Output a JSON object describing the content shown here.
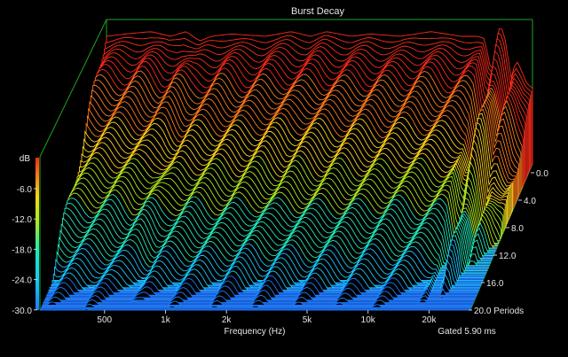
{
  "chart_data": {
    "type": "waterfall",
    "title": "Burst Decay",
    "xlabel": "Frequency (Hz)",
    "x_scale": "log",
    "x_ticks": [
      {
        "value": 500,
        "label": "500"
      },
      {
        "value": 1000,
        "label": "1k"
      },
      {
        "value": 2000,
        "label": "2k"
      },
      {
        "value": 5000,
        "label": "5k"
      },
      {
        "value": 10000,
        "label": "10k"
      },
      {
        "value": 20000,
        "label": "20k"
      }
    ],
    "xlim": [
      240,
      32000
    ],
    "zlabel": "dB",
    "z_ticks": [
      "-6.0",
      "-12.0",
      "-18.0",
      "-24.0",
      "-30.0"
    ],
    "zlim": [
      -30,
      0
    ],
    "y_ticks": [
      "0.0",
      "4.0",
      "8.0",
      "12.0",
      "16.0",
      "20.0 Periods"
    ],
    "ylim": [
      0,
      20
    ],
    "footnote": "Gated 5.90 ms",
    "colorscale": [
      "#1a7cff",
      "#16c8ff",
      "#22e8b8",
      "#b0e81c",
      "#ffd21a",
      "#ff7a1a",
      "#ff2a1a"
    ],
    "background": "#000000",
    "frame_color": "#1fa31f",
    "profile_0_db": [
      [
        240,
        -3
      ],
      [
        300,
        -2.5
      ],
      [
        400,
        -2
      ],
      [
        500,
        -3
      ],
      [
        600,
        -2
      ],
      [
        700,
        -4
      ],
      [
        800,
        -3
      ],
      [
        1000,
        -2.5
      ],
      [
        1500,
        -3
      ],
      [
        2000,
        -2
      ],
      [
        2500,
        -3
      ],
      [
        3000,
        -2
      ],
      [
        4000,
        -3
      ],
      [
        5000,
        -2.5
      ],
      [
        7000,
        -3
      ],
      [
        10000,
        -2
      ],
      [
        14000,
        -3
      ],
      [
        17000,
        -3
      ],
      [
        18500,
        -3.5
      ],
      [
        19500,
        -9
      ],
      [
        20500,
        -10
      ],
      [
        22000,
        0
      ],
      [
        23500,
        -4
      ],
      [
        25000,
        -12
      ],
      [
        26500,
        -8
      ],
      [
        28000,
        -10
      ],
      [
        30000,
        -13
      ],
      [
        32000,
        -14
      ]
    ],
    "floor_level_db": -30,
    "decay_db_per_period": 1.5
  }
}
